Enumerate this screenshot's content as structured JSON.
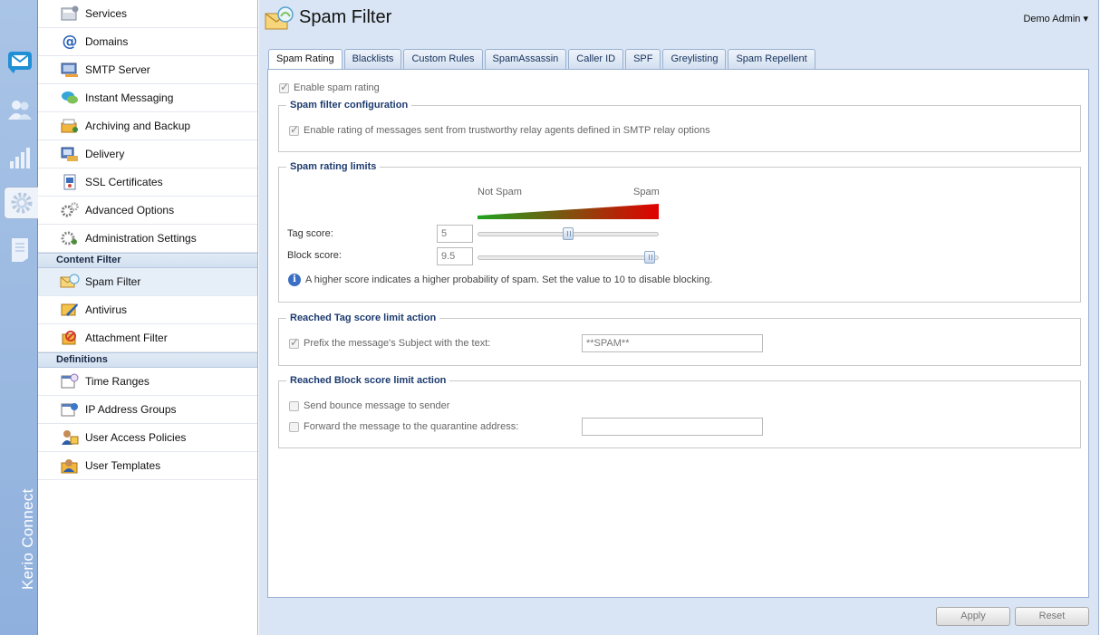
{
  "app": {
    "brand": "Kerio Connect"
  },
  "rail": {
    "items": [
      {
        "name": "mail",
        "icon": "mail-icon"
      },
      {
        "name": "users",
        "icon": "users-icon"
      },
      {
        "name": "status",
        "icon": "bar-chart-icon"
      },
      {
        "name": "configuration",
        "icon": "gear-icon",
        "active": true
      },
      {
        "name": "logs",
        "icon": "document-icon"
      }
    ]
  },
  "nav": {
    "items": [
      {
        "label": "Services",
        "icon": "services-icon"
      },
      {
        "label": "Domains",
        "icon": "at-sign-icon"
      },
      {
        "label": "SMTP Server",
        "icon": "smtp-server-icon"
      },
      {
        "label": "Instant Messaging",
        "icon": "chat-bubble-icon"
      },
      {
        "label": "Archiving and Backup",
        "icon": "archive-icon"
      },
      {
        "label": "Delivery",
        "icon": "delivery-icon"
      },
      {
        "label": "SSL Certificates",
        "icon": "certificate-icon"
      },
      {
        "label": "Advanced Options",
        "icon": "gears-icon"
      },
      {
        "label": "Administration Settings",
        "icon": "admin-settings-icon"
      }
    ],
    "sections": [
      {
        "title": "Content Filter",
        "items": [
          {
            "label": "Spam Filter",
            "icon": "spam-filter-icon",
            "selected": true
          },
          {
            "label": "Antivirus",
            "icon": "antivirus-icon"
          },
          {
            "label": "Attachment Filter",
            "icon": "attachment-filter-icon"
          }
        ]
      },
      {
        "title": "Definitions",
        "items": [
          {
            "label": "Time Ranges",
            "icon": "calendar-clock-icon"
          },
          {
            "label": "IP Address Groups",
            "icon": "ip-groups-icon"
          },
          {
            "label": "User Access Policies",
            "icon": "user-policy-icon"
          },
          {
            "label": "User Templates",
            "icon": "user-template-icon"
          }
        ]
      }
    ]
  },
  "header": {
    "title": "Spam Filter",
    "user": "Demo Admin ▾"
  },
  "tabs": [
    "Spam Rating",
    "Blacklists",
    "Custom Rules",
    "SpamAssassin",
    "Caller ID",
    "SPF",
    "Greylisting",
    "Spam Repellent"
  ],
  "active_tab": "Spam Rating",
  "form": {
    "enable_spam_rating": {
      "label": "Enable spam rating",
      "checked": true
    },
    "config_group": {
      "legend": "Spam filter configuration",
      "trust_relay": {
        "label": "Enable rating of messages sent from trustworthy relay agents defined in SMTP relay options",
        "checked": true
      }
    },
    "limits_group": {
      "legend": "Spam rating limits",
      "scale_left": "Not Spam",
      "scale_right": "Spam",
      "tag_label": "Tag score:",
      "tag_value": "5",
      "tag_level": 0.5,
      "block_label": "Block score:",
      "block_value": "9.5",
      "block_level": 0.95,
      "info": "A higher score indicates a higher probability of spam. Set the value to 10 to disable blocking."
    },
    "tag_action_group": {
      "legend": "Reached Tag score limit action",
      "prefix_label": "Prefix the message's Subject with the text:",
      "prefix_checked": true,
      "prefix_value": "**SPAM**"
    },
    "block_action_group": {
      "legend": "Reached Block score limit action",
      "bounce_label": "Send bounce message to sender",
      "bounce_checked": false,
      "forward_label": "Forward the message to the quarantine address:",
      "forward_checked": false,
      "forward_value": ""
    }
  },
  "footer": {
    "apply_label": "Apply",
    "reset_label": "Reset"
  },
  "colors": {
    "accent": "#1d3b6f",
    "gradient_start": "#1fa31f",
    "gradient_end": "#e00000"
  }
}
